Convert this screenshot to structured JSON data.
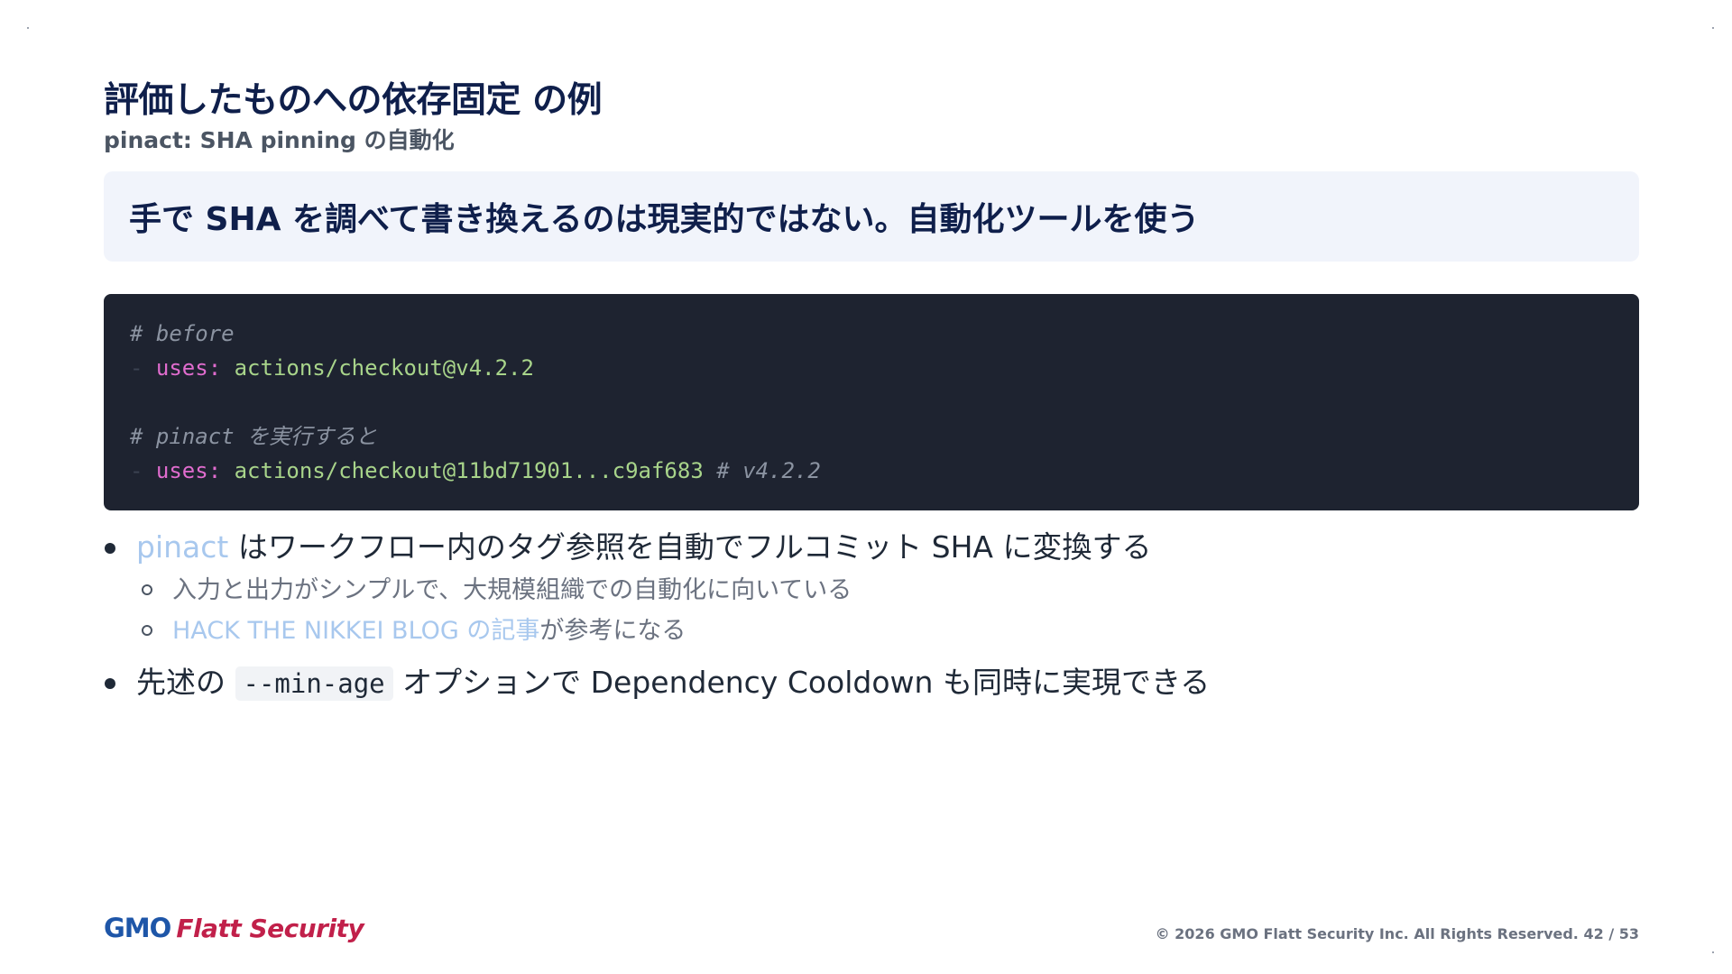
{
  "slide": {
    "title": "評価したものへの依存固定 の例",
    "subtitle": "pinact: SHA pinning の自動化",
    "callout": "手で SHA を調べて書き換えるのは現実的ではない。自動化ツールを使う"
  },
  "code": {
    "line1_comment": "# before",
    "line2_dash": "- ",
    "line2_key": "uses:",
    "line2_value": " actions/checkout@v4.2.2",
    "line4_comment": "# pinact を実行すると",
    "line5_dash": "- ",
    "line5_key": "uses:",
    "line5_value": " actions/checkout@11bd71901...c9af683",
    "line5_comment": " # v4.2.2"
  },
  "bullets": {
    "b1_link": "pinact",
    "b1_text": " はワークフロー内のタグ参照を自動でフルコミット SHA に変換する",
    "b1_sub1": "入力と出力がシンプルで、大規模組織での自動化に向いている",
    "b1_sub2_link": "HACK THE NIKKEI BLOG の記事",
    "b1_sub2_text": "が参考になる",
    "b2_prefix": "先述の ",
    "b2_code": "--min-age",
    "b2_suffix": " オプションで Dependency Cooldown も同時に実現できる"
  },
  "footer": {
    "logo_gmo": "GMO",
    "logo_flatt": "Flatt Security",
    "copyright": "© 2026 GMO Flatt Security Inc. All Rights Reserved.",
    "page_current": "42",
    "page_total": "53"
  },
  "colors": {
    "title": "#0f1f4b",
    "callout_bg": "#f1f4fb",
    "code_bg": "#1e2330",
    "link": "#a8c8ee",
    "logo_gmo": "#1e56a8",
    "logo_flatt": "#c1204a"
  }
}
